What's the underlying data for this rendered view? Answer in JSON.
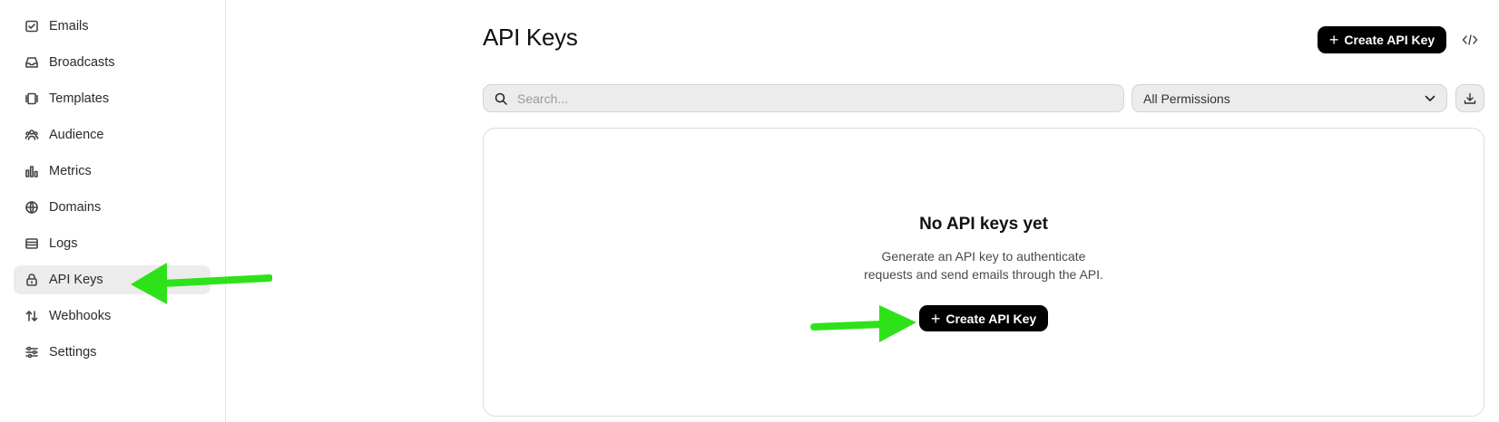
{
  "sidebar": {
    "items": [
      {
        "label": "Emails",
        "icon": "mail-check-icon"
      },
      {
        "label": "Broadcasts",
        "icon": "inbox-icon"
      },
      {
        "label": "Templates",
        "icon": "templates-icon"
      },
      {
        "label": "Audience",
        "icon": "users-icon"
      },
      {
        "label": "Metrics",
        "icon": "bar-chart-icon"
      },
      {
        "label": "Domains",
        "icon": "globe-icon"
      },
      {
        "label": "Logs",
        "icon": "logs-icon"
      },
      {
        "label": "API Keys",
        "icon": "lock-icon",
        "active": true
      },
      {
        "label": "Webhooks",
        "icon": "arrows-updown-icon"
      },
      {
        "label": "Settings",
        "icon": "sliders-icon"
      }
    ]
  },
  "header": {
    "title": "API Keys",
    "create_button": "Create API Key"
  },
  "filters": {
    "search_placeholder": "Search...",
    "permissions_value": "All Permissions"
  },
  "empty_state": {
    "title": "No API keys yet",
    "description_line1": "Generate an API key to authenticate",
    "description_line2": "requests and send emails through the API.",
    "create_button": "Create API Key"
  },
  "colors": {
    "accent": "#000000",
    "annotation_arrow": "#2ee21a",
    "active_nav_bg": "#ececec"
  }
}
